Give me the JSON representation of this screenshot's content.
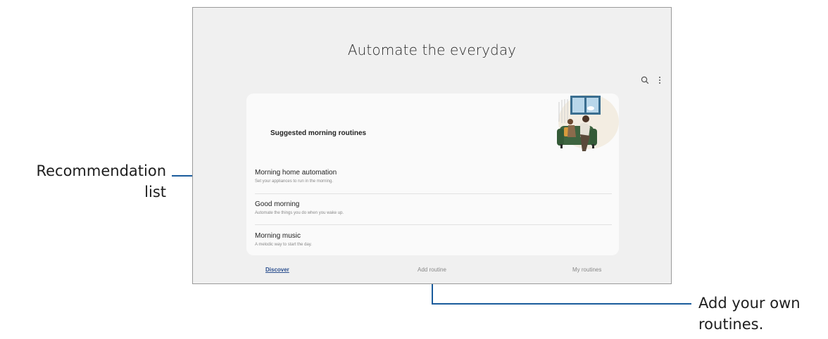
{
  "header": {
    "title": "Automate the everyday"
  },
  "topbar": {
    "icons": [
      "search-icon",
      "more-vert-icon"
    ]
  },
  "recommendation": {
    "heading": "Suggested morning routines",
    "items": [
      {
        "title": "Morning home automation",
        "subtitle": "Set your appliances to run in the morning."
      },
      {
        "title": "Good morning",
        "subtitle": "Automate the things you do when you wake up."
      },
      {
        "title": "Morning music",
        "subtitle": "A melodic way to start the day."
      }
    ]
  },
  "bottom_nav": {
    "tabs": [
      {
        "label": "Discover",
        "active": true
      },
      {
        "label": "Add routine",
        "active": false
      },
      {
        "label": "My routines",
        "active": false
      }
    ]
  },
  "callouts": {
    "left": {
      "line1": "Recommendation",
      "line2": "list"
    },
    "right": {
      "line1": "Add your own",
      "line2": "routines."
    }
  },
  "colors": {
    "accent": "#2b4f8f",
    "callout_line": "#1a5c9c",
    "screen_bg": "#f0f0f0",
    "card_bg": "#fafafa"
  }
}
